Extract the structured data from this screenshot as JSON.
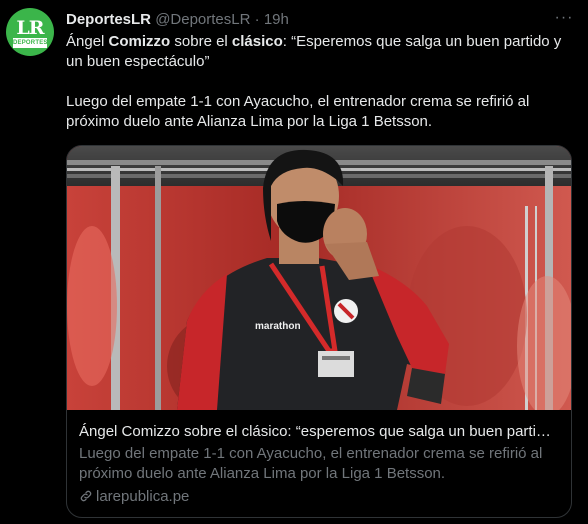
{
  "author": {
    "avatar_letters": "LR",
    "avatar_sub": "DEPORTES",
    "name": "DeportesLR",
    "handle": "@DeportesLR",
    "separator": "·",
    "time": "19h"
  },
  "more_label": "···",
  "tweet": {
    "line1_a": "Ángel ",
    "line1_b": "Comizzo",
    "line1_c": " sobre el ",
    "line1_d": "clásico",
    "line1_e": ": “Esperemos que salga un buen partido y un buen espectáculo”",
    "paragraph2": "Luego del empate 1-1 con Ayacucho, el entrenador crema se refirió al próximo duelo ante Alianza Lima por la Liga 1 Betsson."
  },
  "card": {
    "image_alt": "Ángel Comizzo con mascarilla",
    "jacket_brand": "marathon",
    "title": "Ángel Comizzo sobre el clásico: “esperemos que salga un buen partido y un buen espectáculo”",
    "description": "Luego del empate 1-1 con Ayacucho, el entrenador crema se refirió al próximo duelo ante Alianza Lima por la Liga 1 Betsson.",
    "domain": "larepublica.pe"
  },
  "colors": {
    "background": "#000000",
    "text": "#e7e9ea",
    "secondary": "#71767b",
    "border": "#2f3336",
    "brand_green": "#3bb54a"
  }
}
